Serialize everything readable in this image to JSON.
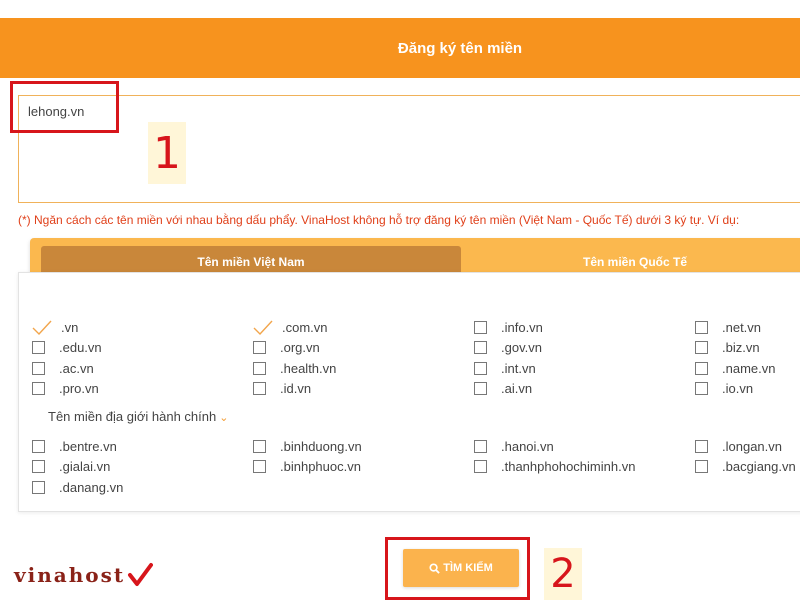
{
  "header": {
    "title": "Đăng ký tên miền"
  },
  "domain_input": {
    "value": "lehong.vn"
  },
  "annotations": {
    "step1": "1",
    "step2": "2"
  },
  "note": "(*) Ngăn cách các tên miền với nhau bằng dấu phẩy. VinaHost không hỗ trợ đăng ký tên miền (Việt Nam -  Quốc Tế) dưới 3 ký tự. Ví dụ:",
  "tabs": [
    {
      "label": "Tên miền Việt Nam",
      "active": true
    },
    {
      "label": "Tên miền Quốc Tế",
      "active": false
    }
  ],
  "extensions": {
    "col1": [
      ".vn",
      ".edu.vn",
      ".ac.vn",
      ".pro.vn"
    ],
    "col2": [
      ".com.vn",
      ".org.vn",
      ".health.vn",
      ".id.vn"
    ],
    "col3": [
      ".info.vn",
      ".gov.vn",
      ".int.vn",
      ".ai.vn"
    ],
    "col4": [
      ".net.vn",
      ".biz.vn",
      ".name.vn",
      ".io.vn"
    ]
  },
  "checked": [
    ".vn",
    ".com.vn"
  ],
  "region": {
    "label": "Tên miền địa giới hành chính",
    "col1": [
      ".bentre.vn",
      ".gialai.vn",
      ".danang.vn"
    ],
    "col2": [
      ".binhduong.vn",
      ".binhphuoc.vn"
    ],
    "col3": [
      ".hanoi.vn",
      ".thanhphohochiminh.vn"
    ],
    "col4": [
      ".longan.vn",
      ".bacgiang.vn"
    ]
  },
  "search_button": {
    "label": "TÌM KIẾM",
    "icon": "search-icon"
  },
  "logo": {
    "text": "vinahost"
  },
  "colors": {
    "accent": "#f7931e",
    "tab_bar": "#fbb84e",
    "active_tab": "#c9873a",
    "highlight": "#d7151b"
  }
}
